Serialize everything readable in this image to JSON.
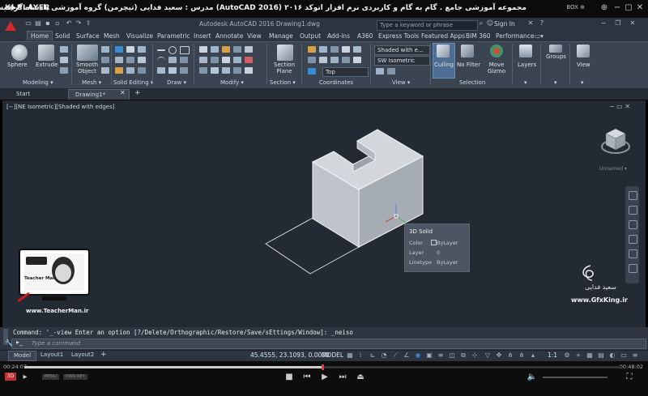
{
  "player": {
    "logo": "K▶PLAYER",
    "title": "مجموعه آموزشی جامع . گام به گام و کاربردی نرم افزار  اتوکد ۲۰۱۶ (AutoCAD 2016)  مدرس : سعید فدایی (تیچرمن) گروه آموزشی پادشاه گرافیست ها",
    "box_label": "BOX ⊕",
    "time_current": "00:24:07",
    "time_total": "00:48:02",
    "progress": 0.5,
    "small_buttons": [
      "MENU",
      "HWD KEY"
    ]
  },
  "app": {
    "title": "Autodesk AutoCAD 2016    Drawing1.dwg",
    "search_placeholder": "Type a keyword or phrase",
    "signin": "Sign In"
  },
  "ribbon_tabs": [
    "Home",
    "Solid",
    "Surface",
    "Mesh",
    "Visualize",
    "Parametric",
    "Insert",
    "Annotate",
    "View",
    "Manage",
    "Output",
    "Add-ins",
    "A360",
    "Express Tools",
    "Featured Apps",
    "BIM 360",
    "Performance"
  ],
  "ribbon": {
    "buttons": {
      "sphere": "Sphere",
      "extrude": "Extrude",
      "smooth_object_1": "Smooth",
      "smooth_object_2": "Object",
      "section_plane_1": "Section",
      "section_plane_2": "Plane",
      "culling": "Culling",
      "no_filter": "No Filter",
      "move_gizmo_1": "Move",
      "move_gizmo_2": "Gizmo",
      "layers": "Layers",
      "groups": "Groups",
      "view": "View"
    },
    "combos": {
      "visual_style": "Shaded with e...",
      "view_direction": "SW Isometric",
      "ucs": "Top"
    },
    "panels": [
      "Modeling ▾",
      "Mesh ▾",
      "Solid Editing ▾",
      "Draw ▾",
      "Modify ▾",
      "Section ▾",
      "Coordinates",
      "View ▾",
      "Selection"
    ]
  },
  "doc_tabs": [
    "Start",
    "Drawing1*"
  ],
  "viewport": {
    "label": "[−][NE Isometric][Shaded with edges]",
    "controls": "− ▭ ✕",
    "viewcube_label": "Unnamed ▾"
  },
  "tooltip": {
    "title": "3D Solid",
    "rows": [
      {
        "key": "Color",
        "value": "ByLayer"
      },
      {
        "key": "Layer",
        "value": "0"
      },
      {
        "key": "Linetype",
        "value": "ByLayer"
      }
    ]
  },
  "watermarks": {
    "teacher_url": "www.TeacherMan.ir",
    "teacher_caption": "Teacher Man",
    "gfx_url": "www.GfxKing.ir",
    "gfx_name": "سعید فدایی"
  },
  "command": {
    "history": "Command: '_-view Enter an option [?/Delete/Orthographic/Restore/Save/sEttings/Window]: _neiso",
    "placeholder": "Type a command"
  },
  "status": {
    "tabs": [
      "Model",
      "Layout1",
      "Layout2"
    ],
    "coords": "45.4555, 23.1093, 0.0000",
    "model": "MODEL",
    "scale": "1:1"
  },
  "colors": {
    "accent": "#3b8ad6",
    "background": "#232a33",
    "ribbon": "#3b4451"
  }
}
